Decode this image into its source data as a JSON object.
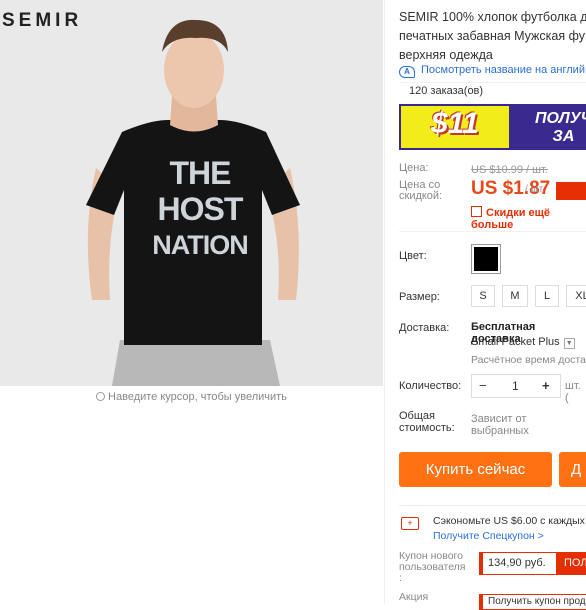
{
  "brand": "SEMIR",
  "zoom_hint": "Наведите курсор, чтобы увеличить",
  "product": {
    "title": "SEMIR 100% хлопок футболка д печатных забавная Мужская фу верхняя одежда",
    "translate_link": "Посмотреть название на англий",
    "orders": "120 заказа(ов)"
  },
  "banner": {
    "price": "$11",
    "line1": "ПОЛУЧ",
    "line2": "ЗА"
  },
  "pricing": {
    "price_label": "Цена:",
    "old_price": "US $10.99 / шт.",
    "discount_label": "Цена со скидкой:",
    "new_price": "US $1.87",
    "per_unit": "/ шт.",
    "discount_link": "Скидки ещё больше"
  },
  "options": {
    "color_label": "Цвет:",
    "size_label": "Размер:",
    "sizes": [
      "S",
      "M",
      "L",
      "XL"
    ]
  },
  "shipping": {
    "label": "Доставка:",
    "free": "Бесплатная доставка",
    "method": "Small Packet Plus",
    "time": "Расчётное время доста"
  },
  "quantity": {
    "label": "Количество:",
    "minus": "−",
    "value": "1",
    "plus": "+",
    "unit": "шт. ("
  },
  "total": {
    "label": "Общая стоимость:",
    "note": "Зависит от выбранных"
  },
  "actions": {
    "buy": "Купить сейчас",
    "cart": "Д"
  },
  "savings": {
    "text": "Сэкономьте US $6.00 с каждых",
    "coupon_link": "Получите Спецкупон >"
  },
  "coupon": {
    "label": "Купон нового пользователя :",
    "value": "134,90 руб.",
    "button": "ПОЛ"
  },
  "promo": {
    "label": "Акция",
    "value": "Получить купон прода"
  },
  "tshirt": {
    "line1": "THE",
    "line2": "HOST",
    "line3": "NATION"
  },
  "colors": {
    "accent": "#ff7113",
    "price": "#e64a19",
    "link": "#2a6fd6",
    "sale": "#e62e04"
  }
}
